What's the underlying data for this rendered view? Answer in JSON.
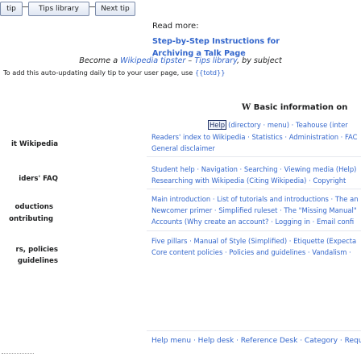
{
  "nav": {
    "prev_label": "tip",
    "library_label": "Tips library",
    "next_label": "Next tip"
  },
  "read_more": {
    "label": "Read more:",
    "link": "Step-by-Step Instructions for Archiving a Talk Page"
  },
  "subtitle": {
    "text1": "Become a ",
    "link1": "Wikipedia tipster",
    "text2": " – ",
    "link2": "Tips library",
    "text3": ", by subject"
  },
  "tip_line": {
    "text1": "To add this auto-updating daily tip to your user page, use ",
    "code": "{{totd}}"
  },
  "basic_info": {
    "icon": "W",
    "title": "Basic information on"
  },
  "help_row": {
    "badge": "Help",
    "text": "(directory · menu) · Teahouse (inter"
  },
  "rows": [
    {
      "label": "it Wikipedia",
      "lines": [
        "Readers' index to Wikipedia · Statistics · Administration · FAC",
        "General disclaimer"
      ]
    },
    {
      "label": "iders' FAQ",
      "lines": [
        "Student help · Navigation · Searching · Viewing media (Help)",
        "Researching with Wikipedia (Citing Wikipedia) · Copyright"
      ]
    },
    {
      "label": "oductions",
      "label2": "ontributing",
      "lines": [
        "Main introduction · List of tutorials and introductions · The an",
        "Newcomer primer · Simplified ruleset · The \"Missing Manual\"",
        "Accounts (Why create an account? · Logging in · Email confi"
      ]
    },
    {
      "label": "rs, policies",
      "label2": "guidelines",
      "lines": [
        "Five pillars · Manual of Style (Simplified) · Etiquette (Expecta",
        "Core content policies · Policies and guidelines · Vandalism ·"
      ]
    }
  ],
  "bottom": {
    "text": "Help menu · Help desk · Reference Desk · Category · Reque"
  },
  "colors": {
    "link": "#3366cc",
    "text": "#202122"
  }
}
